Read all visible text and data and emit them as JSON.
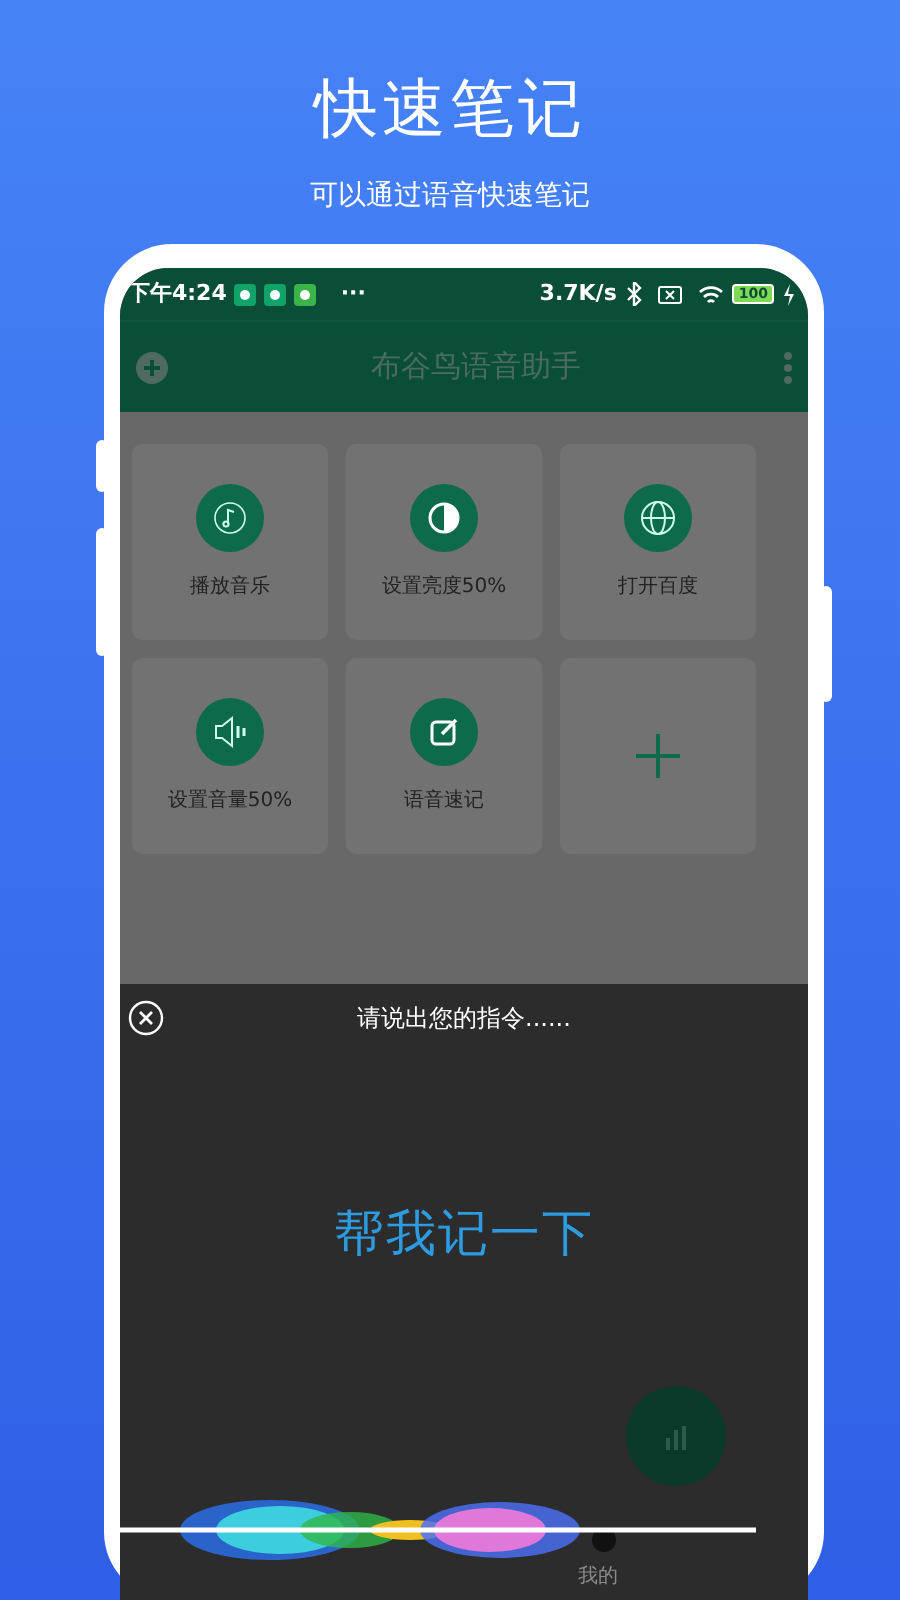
{
  "header": {
    "title": "快速笔记",
    "subtitle": "可以通过语音快速笔记"
  },
  "status_bar": {
    "time": "下午4:24",
    "more": "···",
    "speed": "3.7K/s",
    "battery": "100"
  },
  "app_bar": {
    "title": "布谷鸟语音助手"
  },
  "tiles": [
    {
      "kind": "action",
      "label": "播放音乐"
    },
    {
      "kind": "action",
      "label": "设置亮度50%"
    },
    {
      "kind": "action",
      "label": "打开百度"
    },
    {
      "kind": "action",
      "label": "设置音量50%"
    },
    {
      "kind": "action",
      "label": "语音速记"
    },
    {
      "kind": "add"
    }
  ],
  "voice_panel": {
    "prompt": "请说出您的指令......",
    "recognized": "帮我记一下"
  },
  "bottom_nav": [
    {
      "label": "我的"
    }
  ]
}
